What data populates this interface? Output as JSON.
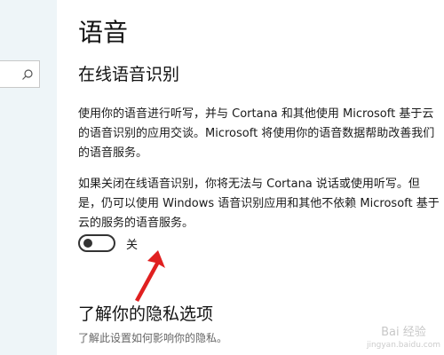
{
  "page": {
    "title": "语音",
    "online_section": {
      "title": "在线语音识别",
      "paragraph1": "使用你的语音进行听写，并与 Cortana 和其他使用 Microsoft 基于云的语音识别的应用交谈。Microsoft 将使用你的语音数据帮助改善我们的语音服务。",
      "paragraph2": "如果关闭在线语音识别，你将无法与 Cortana 说话或使用听写。但是，仍可以使用 Windows 语音识别应用和其他不依赖 Microsoft 基于云的服务的语音服务。",
      "toggle": {
        "label": "关",
        "on": false
      }
    },
    "privacy": {
      "title": "了解你的隐私选项",
      "link": "了解此设置如何影响你的隐私。"
    }
  },
  "sidebar": {
    "search_icon": "search-icon"
  },
  "watermark": {
    "text": "Bai 经验",
    "sub": "jingyan.baidu.com"
  },
  "colors": {
    "sidebar_bg": "#eef5f8",
    "arrow": "#e02020",
    "toggle": "#333333"
  }
}
